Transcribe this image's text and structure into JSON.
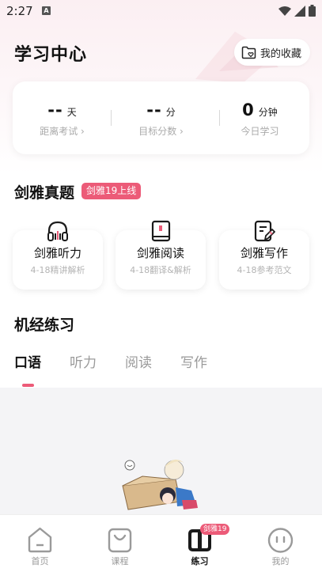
{
  "status_bar": {
    "time": "2:27",
    "notification_badge": "A"
  },
  "header": {
    "title": "学习中心",
    "favorites_label": "我的收藏"
  },
  "stats": [
    {
      "value": "--",
      "unit": "天",
      "label": "距离考试 ›"
    },
    {
      "value": "--",
      "unit": "分",
      "label": "目标分数 ›"
    },
    {
      "value": "0",
      "unit": "分钟",
      "label": "今日学习"
    }
  ],
  "cambridge": {
    "title": "剑雅真题",
    "badge": "剑雅19上线",
    "cards": [
      {
        "title": "剑雅听力",
        "subtitle": "4-18精讲解析",
        "icon": "headphones-icon"
      },
      {
        "title": "剑雅阅读",
        "subtitle": "4-18翻译&解析",
        "icon": "book-icon"
      },
      {
        "title": "剑雅写作",
        "subtitle": "4-18参考范文",
        "icon": "document-edit-icon"
      }
    ]
  },
  "practice": {
    "title": "机经练习",
    "tabs": [
      "口语",
      "听力",
      "阅读",
      "写作"
    ],
    "active_tab": "口语"
  },
  "bottom_nav": {
    "items": [
      {
        "label": "首页",
        "icon": "home-icon"
      },
      {
        "label": "课程",
        "icon": "course-bag-icon"
      },
      {
        "label": "练习",
        "icon": "practice-book-icon",
        "badge": "剑雅19"
      },
      {
        "label": "我的",
        "icon": "profile-face-icon"
      }
    ],
    "active": "练习"
  },
  "colors": {
    "accent": "#ec5b78",
    "text_primary": "#111111",
    "text_muted": "#aaaaaa",
    "background_gray": "#f4f4f6"
  }
}
